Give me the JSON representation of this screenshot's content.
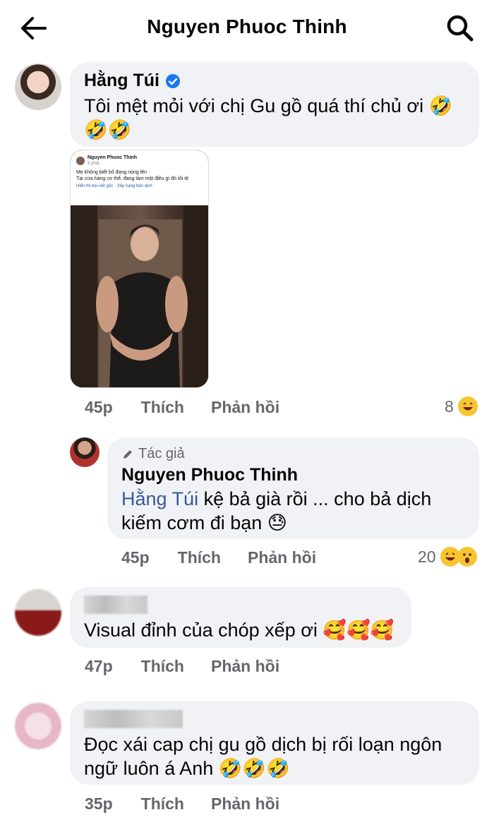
{
  "header": {
    "title": "Nguyen Phuoc Thinh",
    "back_icon": "arrow-left-icon",
    "search_icon": "search-icon"
  },
  "comments": [
    {
      "author": "Hằng Túi",
      "verified": true,
      "text": "Tôi mệt mỏi với chị Gu gồ quá thí chủ ơi 🤣🤣🤣",
      "time": "45p",
      "like": "Thích",
      "reply": "Phản hồi",
      "reaction_count": "8",
      "attachment": {
        "name": "Nguyen Phuoc Thinh",
        "time": "5 phút ·",
        "line1": "Mẹ không biết bố đang nóng lên",
        "line2": "Tại cửa hàng cơ thể, đang làm một điều gì đó tồi tệ",
        "links": "Hiển thị bài viết gốc · Xếp hạng bản dịch"
      }
    },
    {
      "badge": "Tác giả",
      "author": "Nguyen Phuoc Thinh",
      "mention": "Hằng Túi",
      "text": " kệ bả già rồi ... cho bả dịch kiếm cơm đi bạn 😓",
      "time": "45p",
      "like": "Thích",
      "reply": "Phản hồi",
      "reaction_count": "20"
    },
    {
      "text": "Visual đỉnh của chóp xếp ơi 🥰🥰🥰",
      "time": "47p",
      "like": "Thích",
      "reply": "Phản hồi"
    },
    {
      "text": "Đọc xái cap chị gu gồ dịch bị rối loạn ngôn ngữ luôn á Anh 🤣🤣🤣",
      "time": "35p",
      "like": "Thích",
      "reply": "Phản hồi"
    }
  ],
  "colors": {
    "bubble": "#f0f2f5",
    "verified": "#1877f2",
    "mention": "#385898",
    "meta": "#65676b"
  }
}
